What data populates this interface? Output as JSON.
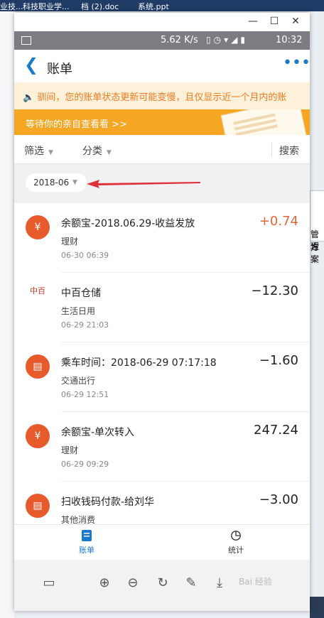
{
  "taskbar": {
    "item1": "业技...",
    "item2": "科技职业学...",
    "item3": "档 (2).doc",
    "item4": "系统.ppt"
  },
  "desktop_right": {
    "line1": "管理",
    "line2": "方案"
  },
  "statusbar": {
    "speed": "5.62 K/s",
    "time": "10:32"
  },
  "header": {
    "title": "账单",
    "more": "•••"
  },
  "notice": {
    "text": "🔈 驯间，您的账单状态更新可能变慢，且仅显示近一个月内的账"
  },
  "banner": {
    "text": "等待你的亲自查看看 >>"
  },
  "filter": {
    "screen_label": "筛选",
    "category_label": "分类",
    "search_label": "搜索"
  },
  "month": {
    "label": "2018-06"
  },
  "transactions": [
    {
      "name": "余额宝-2018.06.29-收益发放",
      "category": "理财",
      "date": "06-30",
      "time": "06:39",
      "amount": "+0.74",
      "icon": "yuebao-icon",
      "glyph": "¥"
    },
    {
      "name": "中百仓储",
      "category": "生活日用",
      "date": "06-29",
      "time": "21:03",
      "amount": "−12.30",
      "icon": "zhongbai-logo-icon",
      "glyph": "中百"
    },
    {
      "name": "乘车时间：2018-06-29 07:17:18",
      "category": "交通出行",
      "date": "06-29",
      "time": "12:51",
      "amount": "−1.60",
      "icon": "shop-icon",
      "glyph": "▤"
    },
    {
      "name": "余额宝-单次转入",
      "category": "理财",
      "date": "06-29",
      "time": "09:29",
      "amount": "247.24",
      "icon": "yuebao-icon",
      "glyph": "¥"
    },
    {
      "name": "扫收钱码付款-给刘华",
      "category": "其他消费",
      "date": "",
      "time": "",
      "amount": "−3.00",
      "icon": "shop-icon",
      "glyph": "▤"
    }
  ],
  "tabs": {
    "bill": "账单",
    "stats": "统计"
  },
  "colors": {
    "accent": "#1a79c8",
    "orange": "#f5a623",
    "positive": "#e0663a",
    "arrow": "#e0303a"
  },
  "watermark": "Bai 经验"
}
